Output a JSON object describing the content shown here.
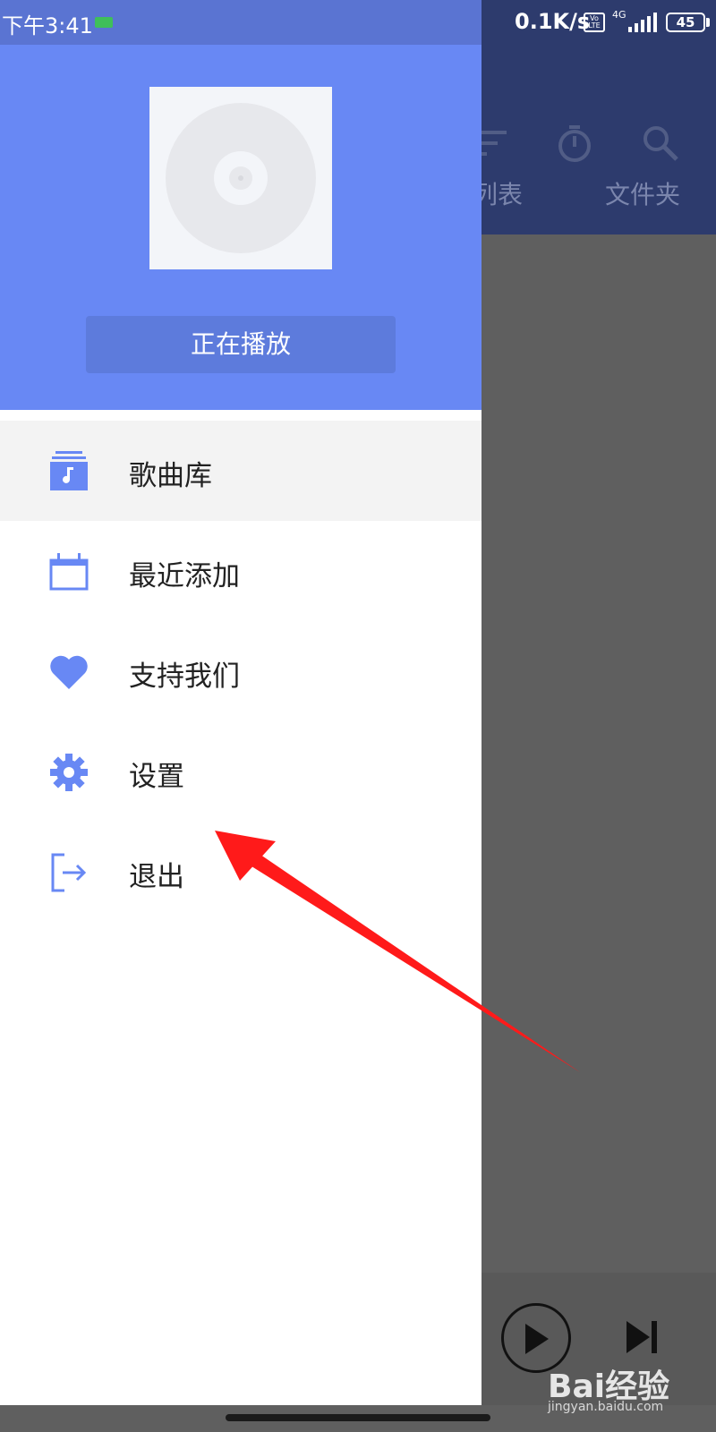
{
  "status_bar": {
    "time": "下午3:41",
    "net_speed": "0.1K/s",
    "volte": "Vo LTE",
    "network": "4G",
    "battery": "45"
  },
  "background_app": {
    "tabs": [
      "列表",
      "文件夹"
    ],
    "toolbar_icons": [
      "sort-icon",
      "timer-icon",
      "search-icon"
    ]
  },
  "drawer": {
    "now_playing_label": "正在播放",
    "menu": [
      {
        "label": "歌曲库",
        "icon": "library-music-icon",
        "active": true
      },
      {
        "label": "最近添加",
        "icon": "calendar-icon",
        "active": false
      },
      {
        "label": "支持我们",
        "icon": "heart-icon",
        "active": false
      },
      {
        "label": "设置",
        "icon": "gear-icon",
        "active": false
      },
      {
        "label": "退出",
        "icon": "exit-icon",
        "active": false
      }
    ]
  },
  "watermark": {
    "brand": "Bai经验",
    "url": "jingyan.baidu.com"
  },
  "colors": {
    "accent": "#6888f4",
    "toolbar_dark": "#2d3b6d",
    "icon": "#6888f4",
    "arrow": "#ff1a1a"
  }
}
